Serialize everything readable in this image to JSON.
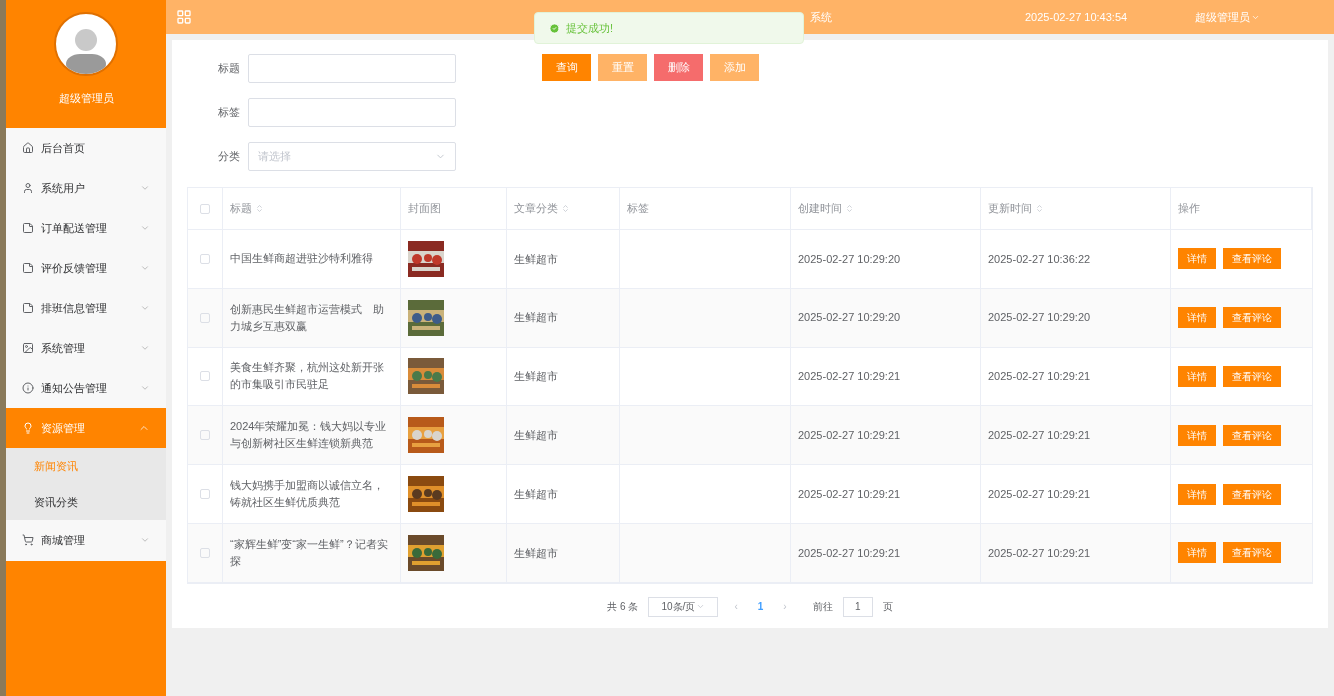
{
  "sidebar": {
    "user_name": "超级管理员",
    "items": [
      {
        "label": "后台首页",
        "selected": false
      },
      {
        "label": "系统用户",
        "expanded": false,
        "selected": false
      },
      {
        "label": "订单配送管理",
        "expanded": false,
        "selected": false
      },
      {
        "label": "评价反馈管理",
        "expanded": false,
        "selected": false
      },
      {
        "label": "排班信息管理",
        "expanded": false,
        "selected": false
      },
      {
        "label": "系统管理",
        "expanded": false,
        "selected": false
      },
      {
        "label": "通知公告管理",
        "expanded": false,
        "selected": false
      },
      {
        "label": "资源管理",
        "expanded": true,
        "selected": true,
        "children": [
          {
            "label": "新闻资讯",
            "selected": true
          },
          {
            "label": "资讯分类",
            "selected": false
          }
        ]
      },
      {
        "label": "商城管理",
        "expanded": false,
        "selected": false
      }
    ]
  },
  "header": {
    "title": "系统",
    "datetime": "2025-02-27 10:43:54",
    "user": "超级管理员"
  },
  "toast": {
    "message": "提交成功!"
  },
  "filters": [
    {
      "label": "标题",
      "kind": "text"
    },
    {
      "label": "标签",
      "kind": "text"
    },
    {
      "label": "分类",
      "kind": "select",
      "placeholder": "请选择"
    }
  ],
  "buttons": [
    {
      "label": "查询",
      "kind": "primary"
    },
    {
      "label": "重置",
      "kind": "light"
    },
    {
      "label": "删除",
      "kind": "danger"
    },
    {
      "label": "添加",
      "kind": "light"
    }
  ],
  "table": {
    "all_checked": false,
    "columns": [
      {
        "label": "标题",
        "sortable": true
      },
      {
        "label": "封面图",
        "sortable": false
      },
      {
        "label": "文章分类",
        "sortable": true
      },
      {
        "label": "标签",
        "sortable": false
      },
      {
        "label": "创建时间",
        "sortable": true
      },
      {
        "label": "更新时间",
        "sortable": true
      },
      {
        "label": "操作",
        "sortable": false
      }
    ],
    "rows": [
      {
        "checked": false,
        "title": "中国生鲜商超进驻沙特利雅得",
        "cover": {
          "kind": "picture"
        },
        "category": "生鲜超市",
        "created": "2025-02-27 10:29:20",
        "updated": "2025-02-27 10:36:22",
        "actions": [
          "详情",
          "查看评论"
        ]
      },
      {
        "checked": false,
        "title": "创新惠民生鲜超市运营模式　助力城乡互惠双赢",
        "cover": {
          "kind": "picture"
        },
        "category": "生鲜超市",
        "created": "2025-02-27 10:29:20",
        "updated": "2025-02-27 10:29:20",
        "actions": [
          "详情",
          "查看评论"
        ]
      },
      {
        "checked": false,
        "title": "美食生鲜齐聚，杭州这处新开张的市集吸引市民驻足",
        "cover": {
          "kind": "picture"
        },
        "category": "生鲜超市",
        "created": "2025-02-27 10:29:21",
        "updated": "2025-02-27 10:29:21",
        "actions": [
          "详情",
          "查看评论"
        ]
      },
      {
        "checked": false,
        "title": "2024年荣耀加冕：钱大妈以专业与创新树社区生鲜连锁新典范",
        "cover": {
          "kind": "picture"
        },
        "category": "生鲜超市",
        "created": "2025-02-27 10:29:21",
        "updated": "2025-02-27 10:29:21",
        "actions": [
          "详情",
          "查看评论"
        ]
      },
      {
        "checked": false,
        "title": "钱大妈携手加盟商以诚信立名，铸就社区生鲜优质典范",
        "cover": {
          "kind": "picture"
        },
        "category": "生鲜超市",
        "created": "2025-02-27 10:29:21",
        "updated": "2025-02-27 10:29:21",
        "actions": [
          "详情",
          "查看评论"
        ]
      },
      {
        "checked": false,
        "title": "“家辉生鲜”变“家一生鲜”？记者实探",
        "cover": {
          "kind": "picture"
        },
        "category": "生鲜超市",
        "created": "2025-02-27 10:29:21",
        "updated": "2025-02-27 10:29:21",
        "actions": [
          "详情",
          "查看评论"
        ]
      }
    ]
  },
  "pagination": {
    "total": "共 6 条",
    "page_size": "10条/页",
    "prev": "‹",
    "pages": [
      {
        "label": "1",
        "selected": true
      }
    ],
    "next": "›",
    "goto_label": "前往",
    "goto_value": "1",
    "goto_suffix": "页"
  }
}
